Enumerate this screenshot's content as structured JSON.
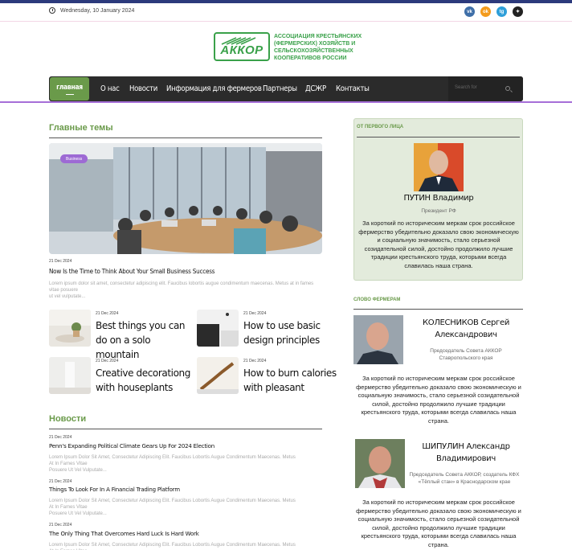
{
  "topbar": {
    "date": "Wednesday, 10 January 2024",
    "social": [
      {
        "icon": "vk-icon",
        "label": "vk",
        "color": "#3f6fa8"
      },
      {
        "icon": "ok-icon",
        "label": "ok",
        "color": "#f39b1c"
      },
      {
        "icon": "telegram-icon",
        "label": "tg",
        "color": "#2e9fd9"
      },
      {
        "icon": "other-icon",
        "label": "✦",
        "color": "#222222"
      }
    ]
  },
  "logo": {
    "mark": "АККОР",
    "text": "АССОЦИАЦИЯ КРЕСТЬЯНСКИХ (ФЕРМЕРСКИХ) ХОЗЯЙСТВ И СЕЛЬСКОХОЗЯЙСТВЕННЫХ КООПЕРАТИВОВ РОССИИ"
  },
  "nav": {
    "items": [
      "главная",
      "О нас",
      "Новости",
      "Информация для фермеров",
      "Партнеры",
      "ДСЖР",
      "Контакты"
    ],
    "search_placeholder": "Search for"
  },
  "main": {
    "section_title": "Главные темы",
    "hero": {
      "badge": "Business",
      "date": "21 Dec 2024",
      "title": "Now Is the Time to Think About Your Small  Business Success",
      "excerpt_1": "Lorem ipsum dolor sit amet, consectetur adipiscing elit. Faucibus lobortis augue condimentum maecenas. Metus at in fames vitae posuere",
      "excerpt_2": "ut vel vulputate..."
    },
    "cards": [
      {
        "date": "21 Dec 2024",
        "line1": "Best things you can",
        "line2": "do on a solo mountain"
      },
      {
        "date": "21 Dec 2024",
        "line1": "How to use basic",
        "line2": "design principles"
      },
      {
        "date": "21 Dec 2024",
        "line1": "Creative decorationg",
        "line2": "with houseplants"
      },
      {
        "date": "21 Dec 2024",
        "line1": "How to burn calories",
        "line2": "with pleasant"
      }
    ],
    "news_title": "Новости",
    "news": [
      {
        "date": "21 Dec 2024",
        "title": "Penn's Expanding Political Climate Gears Up For 2024 Election",
        "ex1": "Lorem Ipsum Dolor Sit Amet, Consectetur Adipiscing Elit. Faucibus Lobortis Augue Condimentum Maecenas. Metus At In Fames Vitae",
        "ex2": "Posuere Ut Vel Vulputate..."
      },
      {
        "date": "21 Dec 2024",
        "title": "Things To Look For In A Financial Trading  Platform",
        "ex1": "Lorem Ipsum Dolor Sit Amet, Consectetur Adipiscing Elit. Faucibus Lobortis Augue Condimentum Maecenas. Metus At In Fames Vitae",
        "ex2": "Posuere Ut Vel Vulputate..."
      },
      {
        "date": "21 Dec 2024",
        "title": "The Only Thing That Overcomes Hard Luck Is Hard Work",
        "ex1": "Lorem Ipsum Dolor Sit Amet, Consectetur Adipiscing Elit. Faucibus Lobortis Augue Condimentum Maecenas. Metus At In Fames Vitae",
        "ex2": ""
      }
    ]
  },
  "sidebar": {
    "first_person_label": "ОТ ПЕРВОГО ЛИЦА",
    "first_person": {
      "name": "ПУТИН Владимир",
      "role": "Президент РФ",
      "quote": "За короткий по историческим меркам срок российское фермерство убедительно доказало свою экономическую и социальную значимость, стало серьезной созидательной силой, достойно продолжило лучшие традиции крестьянского труда, которыми всегда славилась наша страна."
    },
    "farmers_label": "СЛОВО ФЕРМЕРАМ",
    "farmers": [
      {
        "name_1": "КОЛЕСНИКОВ Сергей",
        "name_2": "Александрович",
        "role_1": "Председатель Совета АККОР",
        "role_2": "Ставропольского края",
        "quote": "За короткий по историческим меркам срок российское фермерство убедительно доказало свою экономическую и социальную значимость, стало серьезной созидательной силой, достойно продолжило лучшие традиции крестьянского труда, которыми всегда славилась наша страна."
      },
      {
        "name_1": "ШИПУЛИН Александр",
        "name_2": "Владимирович",
        "role_1": "Председатель Совета АККОР, создатель КФХ",
        "role_2": "«Тёплый стан» в Краснодарском крае",
        "quote": "За короткий по историческим меркам срок российское фермерство убедительно доказало свою экономическую и социальную значимость, стало серьезной созидательной силой, достойно продолжило лучшие традиции крестьянского труда, которыми всегда славилась наша страна."
      }
    ]
  }
}
